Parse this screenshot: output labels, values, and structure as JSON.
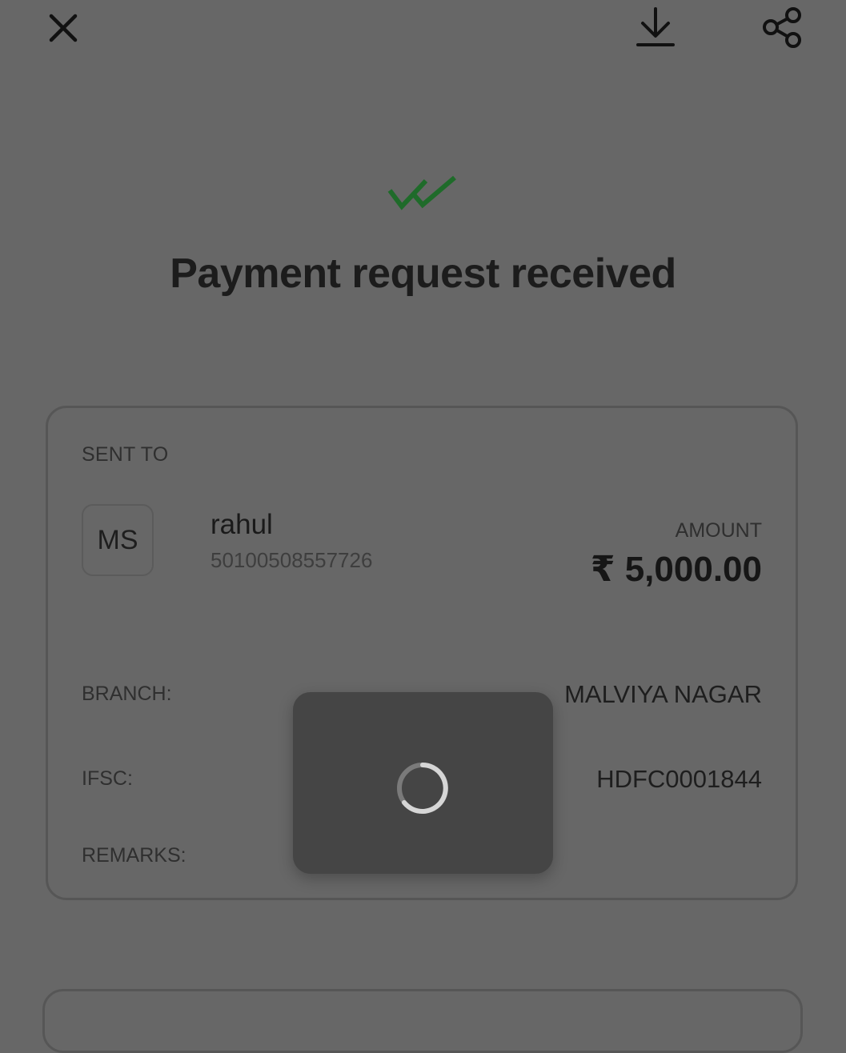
{
  "header": {
    "close_icon": "close-icon",
    "download_icon": "download-icon",
    "share_icon": "share-icon"
  },
  "status": {
    "icon": "double-check-icon",
    "title": "Payment request received",
    "icon_color": "#1f6b2a"
  },
  "card": {
    "sent_to_label": "SENT TO",
    "avatar_initials": "MS",
    "recipient_name": "rahul",
    "account_number": "50100508557726",
    "amount_label": "AMOUNT",
    "amount_value": "₹ 5,000.00",
    "details": [
      {
        "label": "BRANCH:",
        "value": "MALVIYA NAGAR"
      },
      {
        "label": "IFSC:",
        "value": "HDFC0001844"
      },
      {
        "label": "REMARKS:",
        "value": ""
      }
    ]
  },
  "loading": {
    "icon": "loading-spinner-icon"
  }
}
